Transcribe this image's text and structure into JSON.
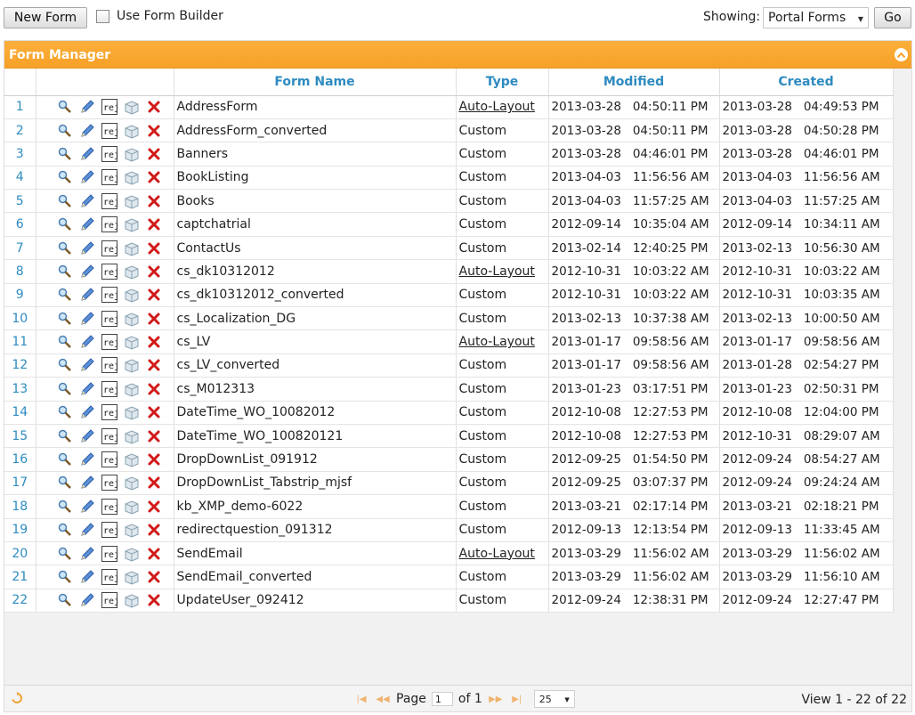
{
  "toolbar": {
    "new_form_label": "New Form",
    "use_form_builder_label": "Use Form Builder",
    "showing_label": "Showing:",
    "showing_value": "Portal Forms",
    "go_label": "Go"
  },
  "panel": {
    "title": "Form Manager"
  },
  "grid": {
    "columns": [
      "Form Name",
      "Type",
      "Modified",
      "Created"
    ],
    "rows": [
      {
        "num": "1",
        "name": "AddressForm",
        "type": "Auto-Layout",
        "modified_date": "2013-03-28",
        "modified_time": "04:50:11 PM",
        "created_date": "2013-03-28",
        "created_time": "04:49:53 PM"
      },
      {
        "num": "2",
        "name": "AddressForm_converted",
        "type": "Custom",
        "modified_date": "2013-03-28",
        "modified_time": "04:50:11 PM",
        "created_date": "2013-03-28",
        "created_time": "04:50:28 PM"
      },
      {
        "num": "3",
        "name": "Banners",
        "type": "Custom",
        "modified_date": "2013-03-28",
        "modified_time": "04:46:01 PM",
        "created_date": "2013-03-28",
        "created_time": "04:46:01 PM"
      },
      {
        "num": "4",
        "name": "BookListing",
        "type": "Custom",
        "modified_date": "2013-04-03",
        "modified_time": "11:56:56 AM",
        "created_date": "2013-04-03",
        "created_time": "11:56:56 AM"
      },
      {
        "num": "5",
        "name": "Books",
        "type": "Custom",
        "modified_date": "2013-04-03",
        "modified_time": "11:57:25 AM",
        "created_date": "2013-04-03",
        "created_time": "11:57:25 AM"
      },
      {
        "num": "6",
        "name": "captchatrial",
        "type": "Custom",
        "modified_date": "2012-09-14",
        "modified_time": "10:35:04 AM",
        "created_date": "2012-09-14",
        "created_time": "10:34:11 AM"
      },
      {
        "num": "7",
        "name": "ContactUs",
        "type": "Custom",
        "modified_date": "2013-02-14",
        "modified_time": "12:40:25 PM",
        "created_date": "2013-02-13",
        "created_time": "10:56:30 AM"
      },
      {
        "num": "8",
        "name": "cs_dk10312012",
        "type": "Auto-Layout",
        "modified_date": "2012-10-31",
        "modified_time": "10:03:22 AM",
        "created_date": "2012-10-31",
        "created_time": "10:03:22 AM"
      },
      {
        "num": "9",
        "name": "cs_dk10312012_converted",
        "type": "Custom",
        "modified_date": "2012-10-31",
        "modified_time": "10:03:22 AM",
        "created_date": "2012-10-31",
        "created_time": "10:03:35 AM"
      },
      {
        "num": "10",
        "name": "cs_Localization_DG",
        "type": "Custom",
        "modified_date": "2013-02-13",
        "modified_time": "10:37:38 AM",
        "created_date": "2013-02-13",
        "created_time": "10:00:50 AM"
      },
      {
        "num": "11",
        "name": "cs_LV",
        "type": "Auto-Layout",
        "modified_date": "2013-01-17",
        "modified_time": "09:58:56 AM",
        "created_date": "2013-01-17",
        "created_time": "09:58:56 AM"
      },
      {
        "num": "12",
        "name": "cs_LV_converted",
        "type": "Custom",
        "modified_date": "2013-01-17",
        "modified_time": "09:58:56 AM",
        "created_date": "2013-01-28",
        "created_time": "02:54:27 PM"
      },
      {
        "num": "13",
        "name": "cs_M012313",
        "type": "Custom",
        "modified_date": "2013-01-23",
        "modified_time": "03:17:51 PM",
        "created_date": "2013-01-23",
        "created_time": "02:50:31 PM"
      },
      {
        "num": "14",
        "name": "DateTime_WO_10082012",
        "type": "Custom",
        "modified_date": "2012-10-08",
        "modified_time": "12:27:53 PM",
        "created_date": "2012-10-08",
        "created_time": "12:04:00 PM"
      },
      {
        "num": "15",
        "name": "DateTime_WO_100820121",
        "type": "Custom",
        "modified_date": "2012-10-08",
        "modified_time": "12:27:53 PM",
        "created_date": "2012-10-31",
        "created_time": "08:29:07 AM"
      },
      {
        "num": "16",
        "name": "DropDownList_091912",
        "type": "Custom",
        "modified_date": "2012-09-25",
        "modified_time": "01:54:50 PM",
        "created_date": "2012-09-24",
        "created_time": "08:54:27 AM"
      },
      {
        "num": "17",
        "name": "DropDownList_Tabstrip_mjsf",
        "type": "Custom",
        "modified_date": "2012-09-25",
        "modified_time": "03:07:37 PM",
        "created_date": "2012-09-24",
        "created_time": "09:24:24 AM"
      },
      {
        "num": "18",
        "name": "kb_XMP_demo-6022",
        "type": "Custom",
        "modified_date": "2013-03-21",
        "modified_time": "02:17:14 PM",
        "created_date": "2013-03-21",
        "created_time": "02:18:21 PM"
      },
      {
        "num": "19",
        "name": "redirectquestion_091312",
        "type": "Custom",
        "modified_date": "2012-09-13",
        "modified_time": "12:13:54 PM",
        "created_date": "2012-09-13",
        "created_time": "11:33:45 AM"
      },
      {
        "num": "20",
        "name": "SendEmail",
        "type": "Auto-Layout",
        "modified_date": "2013-03-29",
        "modified_time": "11:56:02 AM",
        "created_date": "2013-03-29",
        "created_time": "11:56:02 AM"
      },
      {
        "num": "21",
        "name": "SendEmail_converted",
        "type": "Custom",
        "modified_date": "2013-03-29",
        "modified_time": "11:56:02 AM",
        "created_date": "2013-03-29",
        "created_time": "11:56:10 AM"
      },
      {
        "num": "22",
        "name": "UpdateUser_092412",
        "type": "Custom",
        "modified_date": "2012-09-24",
        "modified_time": "12:38:31 PM",
        "created_date": "2012-09-24",
        "created_time": "12:27:47 PM"
      }
    ],
    "row_icons": [
      "search-icon",
      "edit-pencil-icon",
      "rej-icon",
      "box-icon",
      "delete-x-icon"
    ]
  },
  "footer": {
    "page_label": "Page",
    "page_value": "1",
    "of_label": "of 1",
    "rows_per_page": "25",
    "view_info": "View 1 - 22 of 22"
  },
  "colors": {
    "header_orange": "#f7a028",
    "link_blue": "#2e8bc0",
    "delete_red": "#d11818"
  }
}
